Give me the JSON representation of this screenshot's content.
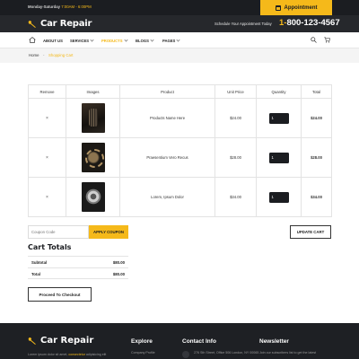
{
  "topbar": {
    "hours_days": "Monday-Saturday",
    "hours_time": "7:00AM - 6:00PM",
    "appointment_label": "Appointment"
  },
  "header": {
    "logo": "Car Repair",
    "schedule_text": "Schedule Your Appointment Today",
    "phone_prefix": "1-",
    "phone_number": "800-123-4567"
  },
  "nav": {
    "items": [
      {
        "label": "ABOUT US"
      },
      {
        "label": "SERVICES"
      },
      {
        "label": "PRODUCTS"
      },
      {
        "label": "BLOGS"
      },
      {
        "label": "PAGES"
      }
    ]
  },
  "breadcrumb": {
    "home": "Home",
    "separator": "-",
    "current": "Shopping Cart"
  },
  "cart": {
    "columns": [
      "Remove",
      "Images",
      "Product",
      "Unit Price",
      "Quantity",
      "Total"
    ],
    "rows": [
      {
        "remove": "×",
        "product": "Products Name Here",
        "unit_price": "$24.00",
        "quantity": "1",
        "total": "$24.00"
      },
      {
        "remove": "×",
        "product": "Praesentium Vero Recus",
        "unit_price": "$28.00",
        "quantity": "1",
        "total": "$28.00"
      },
      {
        "remove": "×",
        "product": "Lorem, Ipsum Dolor",
        "unit_price": "$34.00",
        "quantity": "1",
        "total": "$34.00"
      }
    ]
  },
  "coupon": {
    "placeholder": "Coupon Code",
    "apply_label": "APPLY COUPON",
    "update_label": "UPDATE CART"
  },
  "totals": {
    "title": "Cart Totals",
    "subtotal_label": "Subtotal",
    "subtotal_value": "$80.00",
    "total_label": "Total",
    "total_value": "$80.00",
    "checkout_label": "Proceed To Checkout"
  },
  "footer": {
    "logo": "Car Repair",
    "about_text": "Lorem ipsum dolor sit amet,",
    "about_link": "consectetur",
    "about_rest": "adipisicing elit",
    "columns": [
      {
        "title": "Explore",
        "first_item": "Company Profile"
      },
      {
        "title": "Contact Info",
        "first_item": "276 Sth Street, Office 506 London, NY 00065"
      },
      {
        "title": "Newsletter",
        "first_item": "Join our subscribers list to get the latest"
      }
    ]
  },
  "colors": {
    "accent": "#f5b91a",
    "dark": "#1b1d21",
    "header": "#26282c"
  }
}
